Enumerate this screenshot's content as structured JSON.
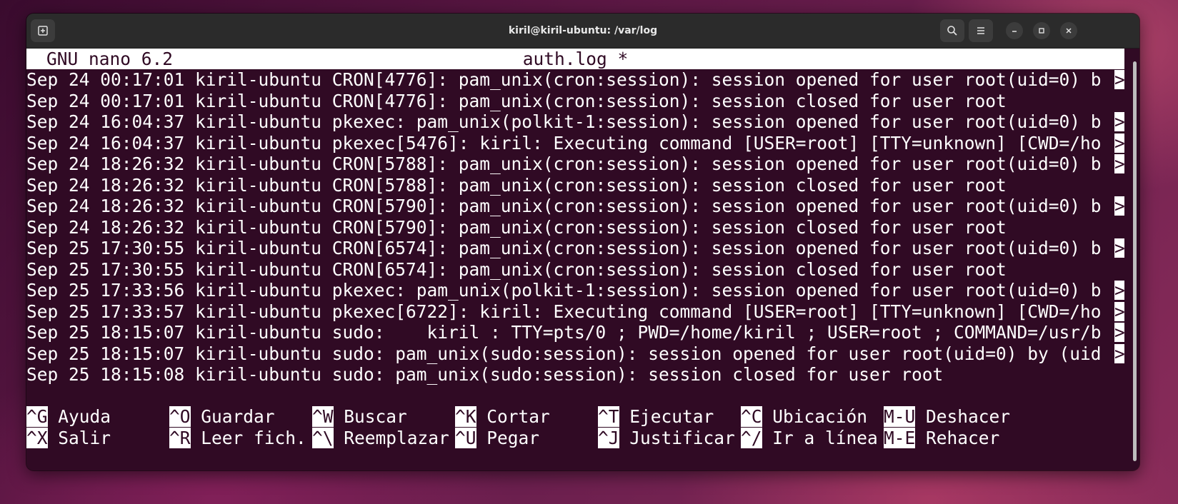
{
  "window": {
    "title": "kiril@kiril-ubuntu: /var/log"
  },
  "icons": {
    "new_tab": "new-tab-icon",
    "search": "search-icon",
    "menu": "hamburger-menu-icon",
    "minimize": "minimize-icon",
    "maximize": "maximize-icon",
    "close": "close-icon"
  },
  "nano": {
    "version": "GNU nano 6.2",
    "filename": "auth.log *"
  },
  "lines": [
    {
      "text": "Sep 24 00:17:01 kiril-ubuntu CRON[4776]: pam_unix(cron:session): session opened for user root(uid=0) b",
      "more": ">"
    },
    {
      "text": "Sep 24 00:17:01 kiril-ubuntu CRON[4776]: pam_unix(cron:session): session closed for user root",
      "more": ""
    },
    {
      "text": "Sep 24 16:04:37 kiril-ubuntu pkexec: pam_unix(polkit-1:session): session opened for user root(uid=0) b",
      "more": ">"
    },
    {
      "text": "Sep 24 16:04:37 kiril-ubuntu pkexec[5476]: kiril: Executing command [USER=root] [TTY=unknown] [CWD=/ho",
      "more": ">"
    },
    {
      "text": "Sep 24 18:26:32 kiril-ubuntu CRON[5788]: pam_unix(cron:session): session opened for user root(uid=0) b",
      "more": ">"
    },
    {
      "text": "Sep 24 18:26:32 kiril-ubuntu CRON[5788]: pam_unix(cron:session): session closed for user root",
      "more": ""
    },
    {
      "text": "Sep 24 18:26:32 kiril-ubuntu CRON[5790]: pam_unix(cron:session): session opened for user root(uid=0) b",
      "more": ">"
    },
    {
      "text": "Sep 24 18:26:32 kiril-ubuntu CRON[5790]: pam_unix(cron:session): session closed for user root",
      "more": ""
    },
    {
      "text": "Sep 25 17:30:55 kiril-ubuntu CRON[6574]: pam_unix(cron:session): session opened for user root(uid=0) b",
      "more": ">"
    },
    {
      "text": "Sep 25 17:30:55 kiril-ubuntu CRON[6574]: pam_unix(cron:session): session closed for user root",
      "more": ""
    },
    {
      "text": "Sep 25 17:33:56 kiril-ubuntu pkexec: pam_unix(polkit-1:session): session opened for user root(uid=0) b",
      "more": ">"
    },
    {
      "text": "Sep 25 17:33:57 kiril-ubuntu pkexec[6722]: kiril: Executing command [USER=root] [TTY=unknown] [CWD=/ho",
      "more": ">"
    },
    {
      "text": "Sep 25 18:15:07 kiril-ubuntu sudo:    kiril : TTY=pts/0 ; PWD=/home/kiril ; USER=root ; COMMAND=/usr/b",
      "more": ">"
    },
    {
      "text": "Sep 25 18:15:07 kiril-ubuntu sudo: pam_unix(sudo:session): session opened for user root(uid=0) by (uid",
      "more": ">"
    },
    {
      "text": "Sep 25 18:15:08 kiril-ubuntu sudo: pam_unix(sudo:session): session closed for user root",
      "more": ""
    }
  ],
  "shortcuts": {
    "row1": [
      {
        "key": "^G",
        "label": " Ayuda"
      },
      {
        "key": "^O",
        "label": " Guardar"
      },
      {
        "key": "^W",
        "label": " Buscar"
      },
      {
        "key": "^K",
        "label": " Cortar"
      },
      {
        "key": "^T",
        "label": " Ejecutar"
      },
      {
        "key": "^C",
        "label": " Ubicación"
      },
      {
        "key": "M-U",
        "label": " Deshacer"
      }
    ],
    "row2": [
      {
        "key": "^X",
        "label": " Salir"
      },
      {
        "key": "^R",
        "label": " Leer fich."
      },
      {
        "key": "^\\",
        "label": " Reemplazar"
      },
      {
        "key": "^U",
        "label": " Pegar"
      },
      {
        "key": "^J",
        "label": " Justificar"
      },
      {
        "key": "^/",
        "label": " Ir a línea"
      },
      {
        "key": "M-E",
        "label": " Rehacer"
      }
    ]
  }
}
